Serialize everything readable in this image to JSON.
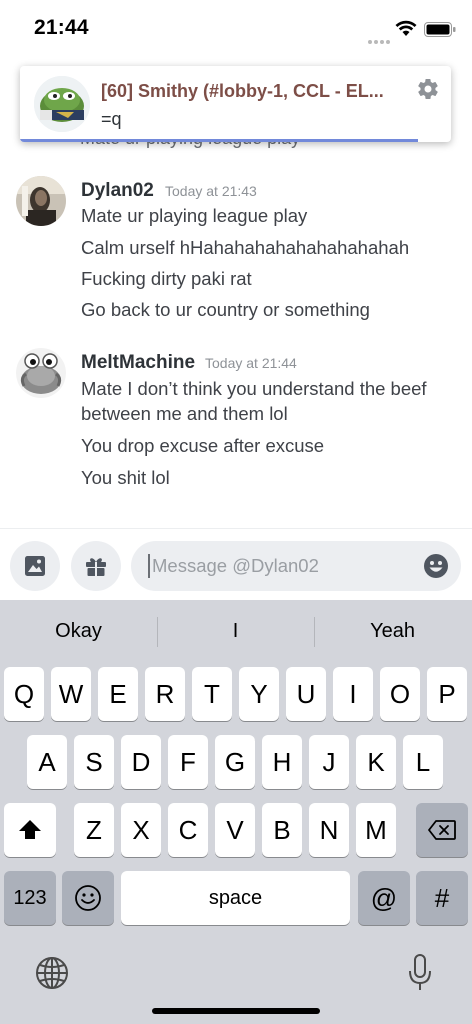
{
  "status_bar": {
    "time": "21:44"
  },
  "notification": {
    "title": "[60] Smithy (#lobby-1, CCL - EL...",
    "body": "=q"
  },
  "hidden_previous_line": "Mate ur playing league play",
  "messages": [
    {
      "author": "Dylan02",
      "timestamp": "Today at 21:43",
      "lines": [
        "Mate ur playing league play",
        "Calm urself hHahahahahahahahahahah",
        "Fucking dirty paki rat",
        "Go back to ur country or something"
      ]
    },
    {
      "author": "MeltMachine",
      "timestamp": "Today at 21:44",
      "lines": [
        "Mate I don’t think you understand the beef",
        "between me and them lol",
        "You drop excuse after excuse",
        "You shit lol"
      ]
    }
  ],
  "composer": {
    "placeholder": "Message @Dylan02"
  },
  "keyboard": {
    "suggestions": [
      "Okay",
      "I",
      "Yeah"
    ],
    "row1": [
      "Q",
      "W",
      "E",
      "R",
      "T",
      "Y",
      "U",
      "I",
      "O",
      "P"
    ],
    "row2": [
      "A",
      "S",
      "D",
      "F",
      "G",
      "H",
      "J",
      "K",
      "L"
    ],
    "row3": [
      "Z",
      "X",
      "C",
      "V",
      "B",
      "N",
      "M"
    ],
    "numbers_label": "123",
    "space_label": "space",
    "at_label": "@",
    "hash_label": "#"
  }
}
